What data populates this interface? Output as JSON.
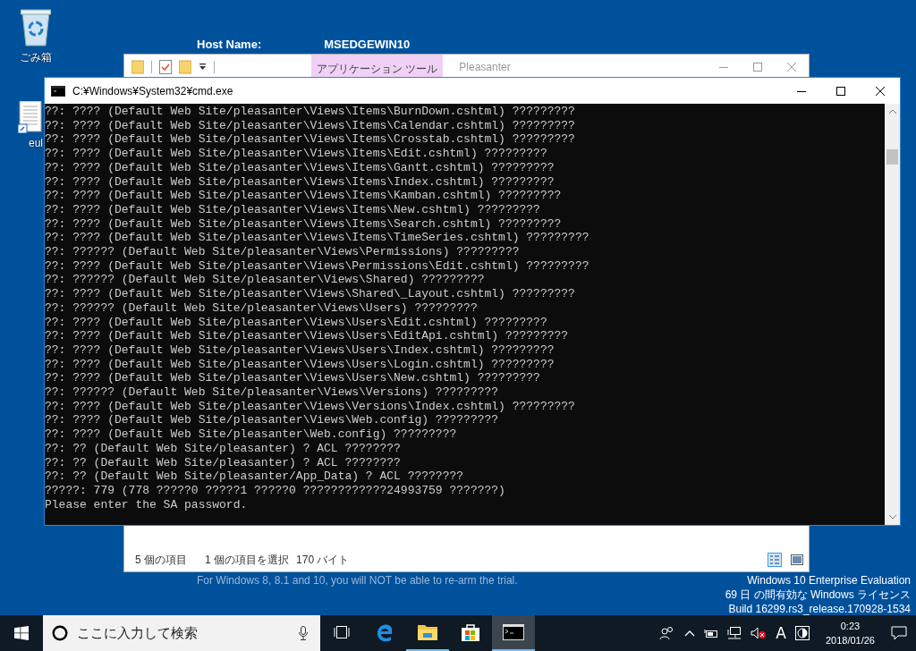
{
  "desktop": {
    "host_label": "Host Name:",
    "host_value": "MSEDGEWIN10",
    "icons": [
      {
        "kind": "recycle",
        "label": "ごみ箱"
      },
      {
        "kind": "file",
        "label": "eul"
      }
    ],
    "notice": "For Windows 8, 8.1 and 10, you will NOT be able to re-arm the trial.",
    "evaluation": [
      "Windows 10 Enterprise Evaluation",
      "69 日 の間有効な Windows ライセンス",
      "Build 16299.rs3_release.170928-1534"
    ]
  },
  "explorer": {
    "context_tab": "アプリケーション ツール",
    "title": "Pleasanter",
    "status_items": "5 個の項目",
    "status_selection": "1 個の項目を選択",
    "status_size": "170 バイト"
  },
  "console": {
    "title": "C:¥Windows¥System32¥cmd.exe",
    "lines": [
      "??: ???? (Default Web Site/pleasanter\\Views\\Items\\BurnDown.cshtml) ?????????",
      "??: ???? (Default Web Site/pleasanter\\Views\\Items\\Calendar.cshtml) ?????????",
      "??: ???? (Default Web Site/pleasanter\\Views\\Items\\Crosstab.cshtml) ?????????",
      "??: ???? (Default Web Site/pleasanter\\Views\\Items\\Edit.cshtml) ?????????",
      "??: ???? (Default Web Site/pleasanter\\Views\\Items\\Gantt.cshtml) ?????????",
      "??: ???? (Default Web Site/pleasanter\\Views\\Items\\Index.cshtml) ?????????",
      "??: ???? (Default Web Site/pleasanter\\Views\\Items\\Kamban.cshtml) ?????????",
      "??: ???? (Default Web Site/pleasanter\\Views\\Items\\New.cshtml) ?????????",
      "??: ???? (Default Web Site/pleasanter\\Views\\Items\\Search.cshtml) ?????????",
      "??: ???? (Default Web Site/pleasanter\\Views\\Items\\TimeSeries.cshtml) ?????????",
      "??: ?????? (Default Web Site/pleasanter\\Views\\Permissions) ?????????",
      "??: ???? (Default Web Site/pleasanter\\Views\\Permissions\\Edit.cshtml) ?????????",
      "??: ?????? (Default Web Site/pleasanter\\Views\\Shared) ?????????",
      "??: ???? (Default Web Site/pleasanter\\Views\\Shared\\_Layout.cshtml) ?????????",
      "??: ?????? (Default Web Site/pleasanter\\Views\\Users) ?????????",
      "??: ???? (Default Web Site/pleasanter\\Views\\Users\\Edit.cshtml) ?????????",
      "??: ???? (Default Web Site/pleasanter\\Views\\Users\\EditApi.cshtml) ?????????",
      "??: ???? (Default Web Site/pleasanter\\Views\\Users\\Index.cshtml) ?????????",
      "??: ???? (Default Web Site/pleasanter\\Views\\Users\\Login.cshtml) ?????????",
      "??: ???? (Default Web Site/pleasanter\\Views\\Users\\New.cshtml) ?????????",
      "??: ?????? (Default Web Site/pleasanter\\Views\\Versions) ?????????",
      "??: ???? (Default Web Site/pleasanter\\Views\\Versions\\Index.cshtml) ?????????",
      "??: ???? (Default Web Site/pleasanter\\Views\\Web.config) ?????????",
      "??: ???? (Default Web Site/pleasanter\\Web.config) ?????????",
      "??: ?? (Default Web Site/pleasanter) ? ACL ????????",
      "??: ?? (Default Web Site/pleasanter) ? ACL ????????",
      "??: ?? (Default Web Site/pleasanter/App_Data) ? ACL ????????",
      "?????: 779 (778 ?????0 ?????1 ?????0 ????????????24993759 ???????)",
      "Please enter the SA password."
    ]
  },
  "taskbar": {
    "search_placeholder": "ここに入力して検索",
    "apps": [
      {
        "kind": "taskview",
        "running": false,
        "selected": false
      },
      {
        "kind": "edge",
        "running": false,
        "selected": false
      },
      {
        "kind": "explorer",
        "running": true,
        "selected": false
      },
      {
        "kind": "store",
        "running": false,
        "selected": false
      },
      {
        "kind": "cmd",
        "running": true,
        "selected": true
      }
    ],
    "ime": "A",
    "time": "0:23",
    "date": "2018/01/26"
  }
}
